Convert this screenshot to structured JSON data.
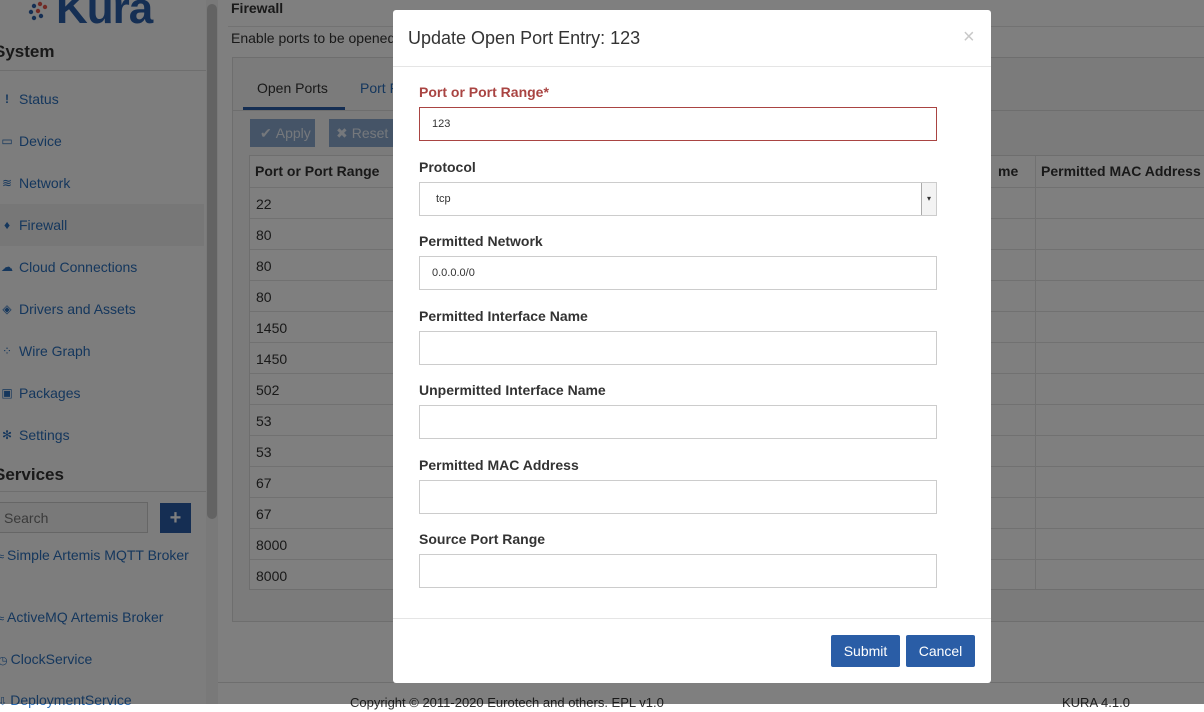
{
  "brand": {
    "logo_text": "Kura"
  },
  "sidebar": {
    "system_title": "System",
    "items": [
      {
        "label": "Status",
        "icon": "exclamation-icon",
        "glyph": "!"
      },
      {
        "label": "Device",
        "icon": "hdd-icon",
        "glyph": "▭"
      },
      {
        "label": "Network",
        "icon": "wifi-icon",
        "glyph": "≋"
      },
      {
        "label": "Firewall",
        "icon": "fire-icon",
        "glyph": "♦"
      },
      {
        "label": "Cloud Connections",
        "icon": "cloud-icon",
        "glyph": "☁"
      },
      {
        "label": "Drivers and Assets",
        "icon": "cube-icon",
        "glyph": "◈"
      },
      {
        "label": "Wire Graph",
        "icon": "graph-icon",
        "glyph": "⁘"
      },
      {
        "label": "Packages",
        "icon": "briefcase-icon",
        "glyph": "▣"
      },
      {
        "label": "Settings",
        "icon": "gear-icon",
        "glyph": "✻"
      }
    ],
    "services_title": "Services",
    "search_placeholder": "Search",
    "add_label": "+",
    "services": [
      {
        "label": "Simple Artemis MQTT Broker",
        "icon": "rss-icon",
        "glyph": "≈"
      },
      {
        "label": "ActiveMQ Artemis Broker",
        "icon": "rss-icon",
        "glyph": "≈"
      },
      {
        "label": "ClockService",
        "icon": "clock-icon",
        "glyph": "◷"
      },
      {
        "label": "DeploymentService",
        "icon": "download-icon",
        "glyph": "⇩"
      }
    ]
  },
  "main": {
    "title": "Firewall",
    "description": "Enable ports to be opened",
    "tabs": {
      "open_ports": "Open Ports",
      "port_forwarding": "Port F"
    },
    "toolbar": {
      "apply": "Apply",
      "reset": "Reset"
    },
    "columns": {
      "port": "Port or Port Range",
      "interface": "me",
      "mac": "Permitted MAC Address"
    },
    "rows": [
      "22",
      "80",
      "80",
      "80",
      "1450",
      "1450",
      "502",
      "53",
      "53",
      "67",
      "67",
      "8000",
      "8000"
    ],
    "footer": "Copyright © 2011-2020 Eurotech and others. EPL v1.0",
    "version": "KURA 4.1.0"
  },
  "modal": {
    "title": "Update Open Port Entry: 123",
    "close": "×",
    "fields": {
      "port_label": "Port or Port Range*",
      "port_value": "123",
      "protocol_label": "Protocol",
      "protocol_value": "tcp",
      "network_label": "Permitted Network",
      "network_value": "0.0.0.0/0",
      "iface_label": "Permitted Interface Name",
      "iface_value": "",
      "uniface_label": "Unpermitted Interface Name",
      "uniface_value": "",
      "mac_label": "Permitted MAC Address",
      "mac_value": "",
      "srcport_label": "Source Port Range",
      "srcport_value": ""
    },
    "submit": "Submit",
    "cancel": "Cancel"
  },
  "colors": {
    "accent": "#2a5da6",
    "error": "#a94442",
    "link": "#2a6ebb"
  }
}
